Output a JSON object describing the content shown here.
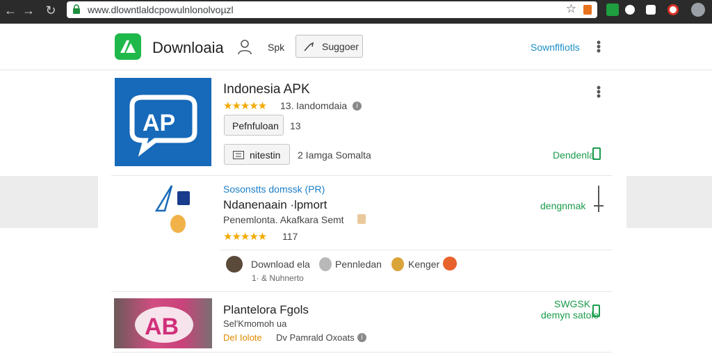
{
  "browser": {
    "url": "www.dlowntlaldcpowulnlonolvoµzl",
    "back_icon": "arrow-left-icon",
    "forward_icon": "arrow-right-icon",
    "reload_icon": "reload-icon"
  },
  "header": {
    "brand": "Downloaia",
    "link": "Spk",
    "suggest_label": "Suggoer",
    "right_link": "Sownflfiotls"
  },
  "colors": {
    "accent_green": "#1fb84a",
    "link_blue": "#1a8fc8",
    "star_gold": "#f2a900",
    "app_blue": "#1769b9"
  },
  "card1": {
    "title": "Indonesia APK",
    "rating_count": "13.",
    "category": "Iandomdaia",
    "button1": "Pefnfuloan",
    "button1_count": "13",
    "button2": "nitestin",
    "meta": "2 Iamga Somalta",
    "download_link": "Dendenla",
    "stars": "★★★★★",
    "image_text": "AP"
  },
  "card2": {
    "subtitle": "Sosonstts domssk (PR)",
    "title": "Ndanenaain ·lpmort",
    "developer": "Penemlonta. Akafkara Semt",
    "stars": "★★★★★",
    "rating_count": "117",
    "download_link": "dengnmak",
    "reviewers": [
      {
        "name": "Download ela"
      },
      {
        "name": "Pennledan"
      },
      {
        "name": "Kenger"
      }
    ],
    "review_meta": "1· & Nuhnerto"
  },
  "card3": {
    "title": "Plantelora Fgols",
    "subtitle": "Sel'Kmomoh ua",
    "meta_orange": "DeI Iolote",
    "meta": "Dv Pamrald Oxoats",
    "link_line1": "SWGSK",
    "link_line2": "demyn satole",
    "image_text": "AB"
  }
}
